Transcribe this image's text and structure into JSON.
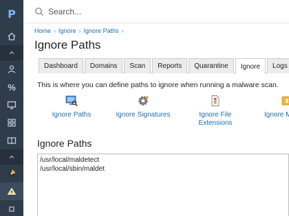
{
  "sidebar": {
    "logo": "P",
    "items": [
      {
        "name": "home-icon",
        "glyph": "⌂"
      },
      {
        "name": "collapse-up-icon",
        "glyph": "⌃",
        "section": true
      },
      {
        "name": "user-icon",
        "glyph": "👤"
      },
      {
        "name": "percent-icon",
        "glyph": "%"
      },
      {
        "name": "monitor-icon",
        "glyph": "🖵"
      },
      {
        "name": "grid-icon",
        "glyph": "▦"
      },
      {
        "name": "book-icon",
        "glyph": "📖"
      },
      {
        "name": "collapse-up-icon-2",
        "glyph": "⌃",
        "section": true
      },
      {
        "name": "plugin-icon-1",
        "glyph": "◈"
      },
      {
        "name": "maldet-icon",
        "glyph": "▲",
        "active": true
      },
      {
        "name": "shield-icon",
        "glyph": "▣"
      }
    ]
  },
  "search": {
    "placeholder": "Search..."
  },
  "breadcrumb": [
    "Home",
    "Ignore",
    "Ignore Paths"
  ],
  "page_title": "Ignore Paths",
  "tabs": [
    {
      "label": "Dashboard"
    },
    {
      "label": "Domains"
    },
    {
      "label": "Scan"
    },
    {
      "label": "Reports"
    },
    {
      "label": "Quarantine"
    },
    {
      "label": "Ignore",
      "active": true
    },
    {
      "label": "Logs"
    }
  ],
  "intro": "This is where you can define paths to ignore when running a malware scan.",
  "icons": [
    {
      "label": "Ignore Paths",
      "icon": "monitor-search-icon"
    },
    {
      "label": "Ignore Signatures",
      "icon": "gear-icon"
    },
    {
      "label": "Ignore File Extensions",
      "icon": "file-extension-icon"
    },
    {
      "label": "Ignore M",
      "icon": "folder-icon"
    }
  ],
  "section_title": "Ignore Paths",
  "paths": "/usr/local/maldetect\n/usr/local/sbin/maldet",
  "colors": {
    "sidebar": "#2f3c4a",
    "link": "#1a6fb5"
  }
}
